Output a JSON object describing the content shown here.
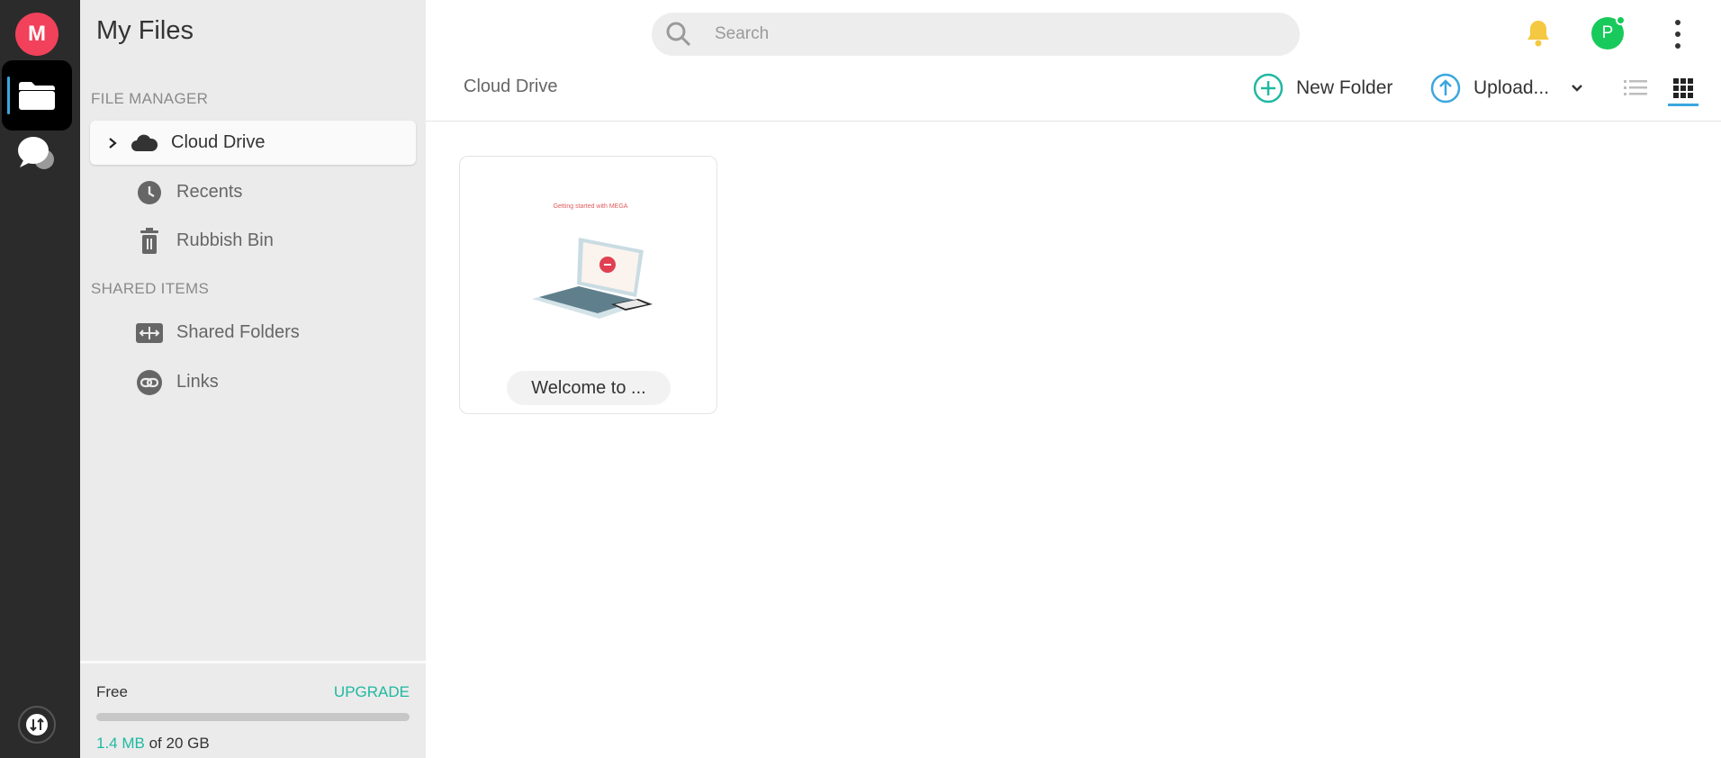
{
  "rail": {
    "logo_letter": "M"
  },
  "sidebar": {
    "title": "My Files",
    "sections": [
      {
        "label": "FILE MANAGER",
        "items": [
          {
            "label": "Cloud Drive",
            "icon": "cloud-icon",
            "active": true
          },
          {
            "label": "Recents",
            "icon": "clock-icon"
          },
          {
            "label": "Rubbish Bin",
            "icon": "trash-icon"
          }
        ]
      },
      {
        "label": "SHARED ITEMS",
        "items": [
          {
            "label": "Shared Folders",
            "icon": "shared-folder-icon"
          },
          {
            "label": "Links",
            "icon": "link-icon"
          }
        ]
      }
    ]
  },
  "storage": {
    "plan": "Free",
    "upgrade_label": "UPGRADE",
    "used": "1.4 MB",
    "of_total": "of 20 GB",
    "used_fraction": 7e-05
  },
  "topbar": {
    "search_placeholder": "Search",
    "avatar_letter": "P"
  },
  "toolbar": {
    "breadcrumb": "Cloud Drive",
    "new_folder_label": "New Folder",
    "upload_label": "Upload..."
  },
  "files": [
    {
      "name": "Welcome to ...",
      "thumb_caption": "Getting started with MEGA"
    }
  ],
  "colors": {
    "accent": "#1fb9a0",
    "brand": "#f2415a",
    "upload_blue": "#3aa7df",
    "avatar_green": "#18c95b",
    "bell_yellow": "#f5c842"
  }
}
